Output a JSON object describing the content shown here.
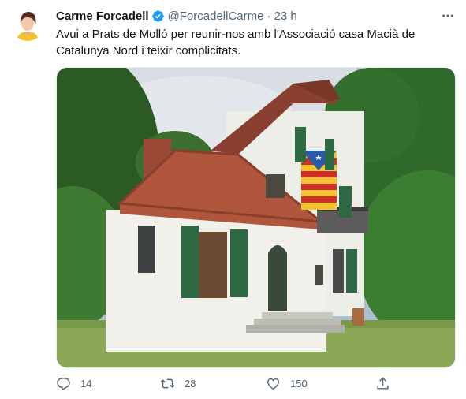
{
  "tweet": {
    "author_name": "Carme Forcadell",
    "handle": "@ForcadellCarme",
    "separator": "·",
    "time": "23 h",
    "text_line1": "Avui a Prats de Molló per reunir-nos amb l'Associació casa Macià de",
    "text_line2": "Catalunya Nord i teixir complicitats."
  },
  "actions": {
    "replies": "14",
    "retweets": "28",
    "likes": "150"
  },
  "icons": {
    "verified": "verified-badge-icon",
    "more": "more-options-icon",
    "reply": "reply-icon",
    "retweet": "retweet-icon",
    "like": "heart-icon",
    "share": "share-icon"
  },
  "colors": {
    "verified": "#1d9bf0",
    "muted": "#536471",
    "text": "#0f1419"
  }
}
